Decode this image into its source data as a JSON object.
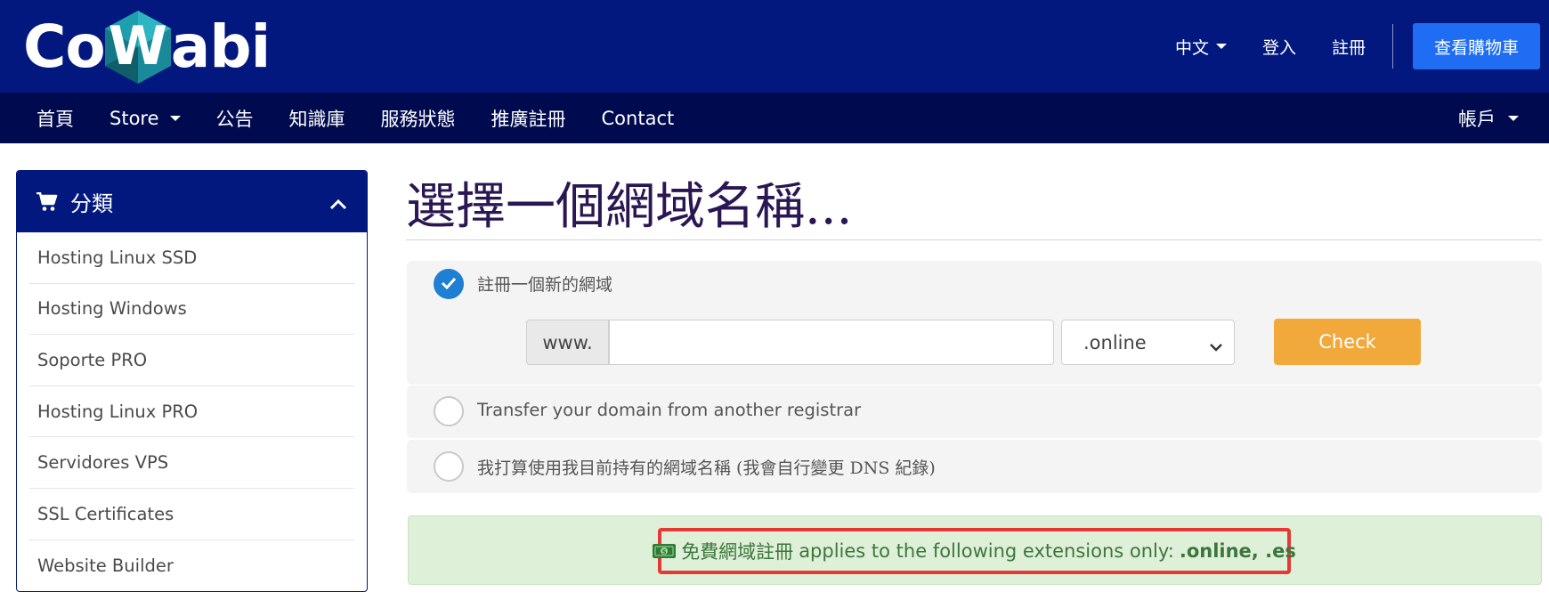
{
  "header": {
    "logo_text_left": "Co",
    "logo_text_mid": "W",
    "logo_text_right": "abi",
    "language": "中文",
    "login": "登入",
    "register": "註冊",
    "cart_button": "查看購物車"
  },
  "nav": {
    "items": [
      "首頁",
      "Store",
      "公告",
      "知識庫",
      "服務狀態",
      "推廣註冊",
      "Contact"
    ],
    "account": "帳戶"
  },
  "sidebar": {
    "title": "分類",
    "items": [
      "Hosting Linux SSD",
      "Hosting Windows",
      "Soporte PRO",
      "Hosting Linux PRO",
      "Servidores VPS",
      "SSL Certificates",
      "Website Builder"
    ]
  },
  "main": {
    "title": "選擇一個網域名稱...",
    "option_register": "註冊一個新的網域",
    "www_prefix": "www.",
    "domain_value": "",
    "tld_selected": ".online",
    "check_button": "Check",
    "option_transfer": "Transfer your domain from another registrar",
    "option_own": "我打算使用我目前持有的網域名稱 (我會自行變更 DNS 紀錄)"
  },
  "promo": {
    "free_label": "免費網域註冊",
    "text": "applies to the following extensions only:",
    "extensions": ".online, .es"
  },
  "colors": {
    "header_bg": "#02187f",
    "nav_bg": "#000a4f",
    "cart_button": "#1f6df3",
    "check_button": "#f2a93b",
    "radio_checked": "#1f7fd3",
    "promo_bg": "#dff0d8",
    "promo_text": "#3c763d",
    "highlight_border": "#e53935",
    "title": "#2a1653"
  },
  "icons": [
    "cart-icon",
    "chevron-up-icon",
    "chevron-down-icon",
    "check-icon",
    "money-icon"
  ]
}
